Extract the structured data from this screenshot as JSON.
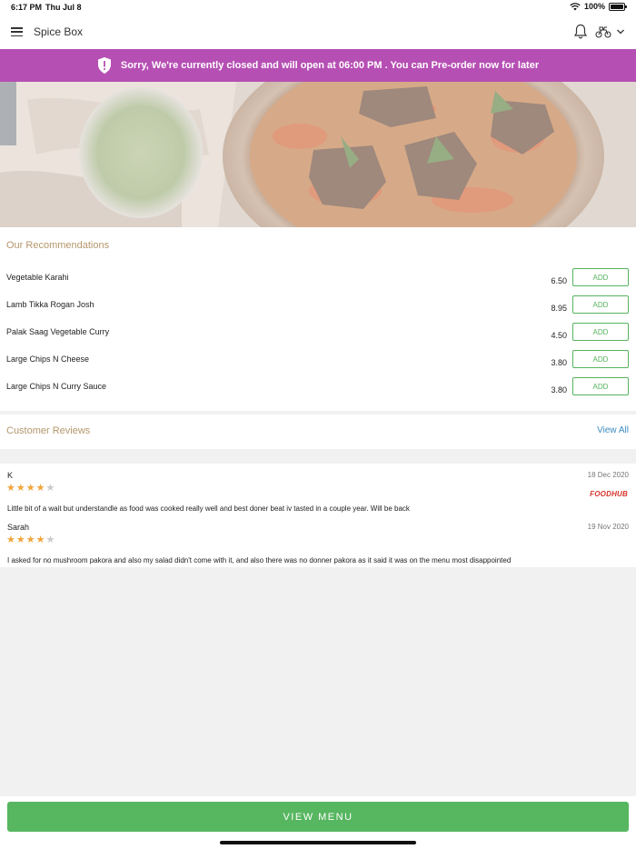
{
  "status_bar": {
    "time": "6:17 PM",
    "date": "Thu Jul 8",
    "battery": "100%"
  },
  "header": {
    "title": "Spice Box"
  },
  "banner": {
    "text": "Sorry, We're currently closed and will open at 06:00 PM . You can Pre-order now for later"
  },
  "recommendations": {
    "title": "Our Recommendations",
    "add_label": "ADD",
    "items": [
      {
        "name": "Vegetable Karahi",
        "price": "6.50"
      },
      {
        "name": "Lamb Tikka Rogan Josh",
        "price": "8.95"
      },
      {
        "name": "Palak Saag Vegetable Curry",
        "price": "4.50"
      },
      {
        "name": "Large Chips N Cheese",
        "price": "3.80"
      },
      {
        "name": "Large Chips N Curry Sauce",
        "price": "3.80"
      }
    ]
  },
  "reviews": {
    "title": "Customer Reviews",
    "view_all": "View All",
    "items": [
      {
        "name": "K",
        "date": "18 Dec 2020",
        "rating": 4,
        "source": "FOODHUB",
        "text": "Little bit of a wait but understandle as food was cooked really well and best doner beat iv tasted in a couple year. Will be back"
      },
      {
        "name": "Sarah",
        "date": "19 Nov 2020",
        "rating": 4,
        "text": "I asked for no mushroom pakora and also my salad didn't come with it, and also there was no donner pakora as it said it was on the menu most disappointed"
      }
    ]
  },
  "footer": {
    "button": "VIEW MENU"
  },
  "colors": {
    "banner": "#b64fb4",
    "accent_green": "#57b660",
    "section_title": "#b5976c",
    "link": "#3a8bbf",
    "star": "#f0a43a"
  },
  "icons": [
    "menu-icon",
    "bell-icon",
    "bike-icon",
    "chevron-down-icon",
    "shield-icon",
    "wifi-icon",
    "battery-icon",
    "star-icon"
  ]
}
